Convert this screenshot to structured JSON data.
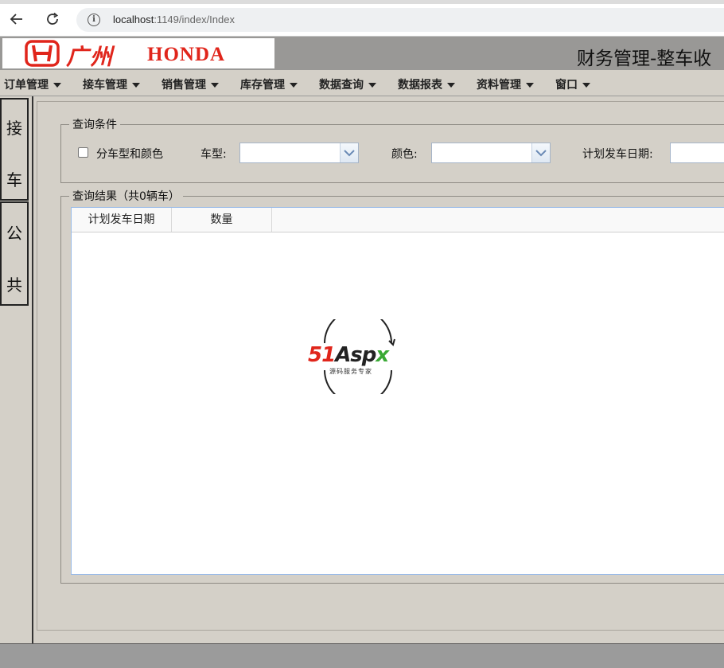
{
  "browser": {
    "url_host": "localhost",
    "url_rest": ":1149/index/Index"
  },
  "header": {
    "brand_cn": "广州",
    "brand_en": "HONDA",
    "title": "财务管理-整车收"
  },
  "menu": [
    {
      "label": "订单管理"
    },
    {
      "label": "接车管理"
    },
    {
      "label": "销售管理"
    },
    {
      "label": "库存管理"
    },
    {
      "label": "数据查询"
    },
    {
      "label": "数据报表"
    },
    {
      "label": "资料管理"
    },
    {
      "label": "窗口"
    }
  ],
  "side_tabs": [
    {
      "chars": [
        "接",
        "车"
      ]
    },
    {
      "chars": [
        "公",
        "共"
      ]
    }
  ],
  "query": {
    "legend": "查询条件",
    "split_checkbox_label": "分车型和颜色",
    "split_checked": false,
    "model_label": "车型:",
    "model_value": "",
    "color_label": "颜色:",
    "color_value": "",
    "date_label": "计划发车日期:",
    "date_value": ""
  },
  "results": {
    "legend": "查询结果（共0辆车）",
    "columns": [
      "计划发车日期",
      "数量"
    ],
    "rows": []
  },
  "watermark": {
    "brand": "51Aspx",
    "tagline": "源码服务专家"
  },
  "colors": {
    "brand_red": "#e0251b",
    "accent_green": "#3aa935",
    "panel_bg": "#d4d0c8"
  }
}
